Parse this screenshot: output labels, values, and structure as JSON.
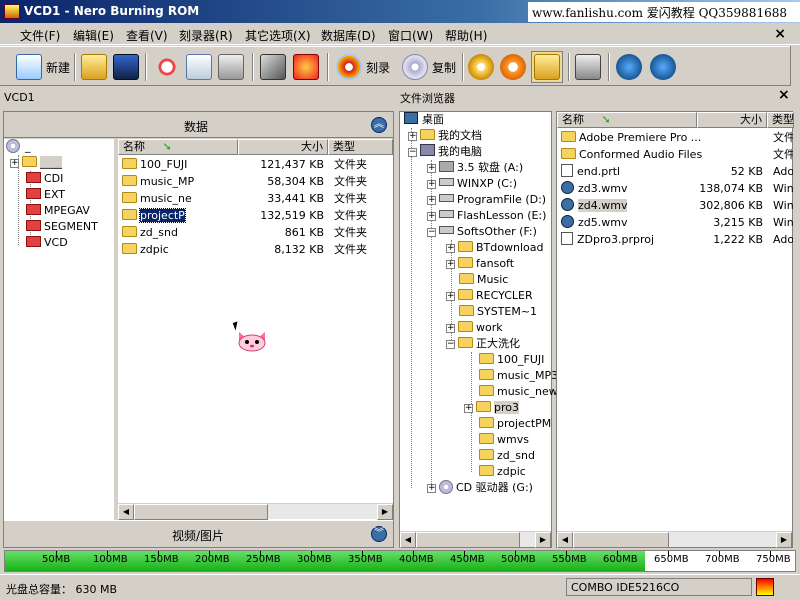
{
  "window": {
    "title": "VCD1 - Nero Burning ROM",
    "watermark": "www.fanlishu.com 爱闪教程 QQ359881688"
  },
  "menu": {
    "items": [
      "文件(F)",
      "编辑(E)",
      "查看(V)",
      "刻录器(R)",
      "其它选项(X)",
      "数据库(D)",
      "窗口(W)",
      "帮助(H)"
    ],
    "close": "×"
  },
  "toolbar": {
    "new_label": "新建",
    "burn_label": "刻录",
    "copy_label": "复制"
  },
  "compilation": {
    "label": "VCD1",
    "data_title": "数据",
    "video_title": "视频/图片",
    "tree": {
      "root": "_",
      "folder": "____",
      "items": [
        "CDI",
        "EXT",
        "MPEGAV",
        "SEGMENT",
        "VCD"
      ]
    },
    "columns": {
      "name": "名称",
      "size": "大小",
      "type": "类型"
    },
    "files": [
      {
        "name": "100_FUJI",
        "size": "121,437 KB",
        "type": "文件夹"
      },
      {
        "name": "music_MP",
        "size": "58,304 KB",
        "type": "文件夹"
      },
      {
        "name": "music_ne",
        "size": "33,441 KB",
        "type": "文件夹"
      },
      {
        "name": "projectP",
        "size": "132,519 KB",
        "type": "文件夹"
      },
      {
        "name": "zd_snd",
        "size": "861 KB",
        "type": "文件夹"
      },
      {
        "name": "zdpic",
        "size": "8,132 KB",
        "type": "文件夹"
      }
    ]
  },
  "browser": {
    "label": "文件浏览器",
    "close": "×",
    "tree": {
      "desktop": "桌面",
      "my_docs": "我的文档",
      "my_computer": "我的电脑",
      "drives": [
        "3.5 软盘 (A:)",
        "WINXP (C:)",
        "ProgramFile (D:)",
        "FlashLesson (E:)",
        "SoftsOther (F:)"
      ],
      "f_children": [
        "BTdownload",
        "fansoft",
        "Music",
        "RECYCLER",
        "SYSTEM~1",
        "work",
        "正大洗化"
      ],
      "zd_children": [
        "100_FUJI",
        "music_MP3",
        "music_new",
        "pro3",
        "projectPM",
        "wmvs",
        "zd_snd",
        "zdpic"
      ],
      "cd_drive": "CD 驱动器 (G:)"
    },
    "columns": {
      "name": "名称",
      "size": "大小",
      "type": "类型"
    },
    "files": [
      {
        "name": "Adobe Premiere Pro ...",
        "size": "",
        "type": "文件",
        "icon": "folder"
      },
      {
        "name": "Conformed Audio Files",
        "size": "",
        "type": "文件",
        "icon": "folder"
      },
      {
        "name": "end.prtl",
        "size": "52 KB",
        "type": "Ado",
        "icon": "file"
      },
      {
        "name": "zd3.wmv",
        "size": "138,074 KB",
        "type": "Wind",
        "icon": "wmv"
      },
      {
        "name": "zd4.wmv",
        "size": "302,806 KB",
        "type": "Wind",
        "icon": "wmv"
      },
      {
        "name": "zd5.wmv",
        "size": "3,215 KB",
        "type": "Wind",
        "icon": "wmv"
      },
      {
        "name": "ZDpro3.prproj",
        "size": "1,222 KB",
        "type": "Ado",
        "icon": "file"
      }
    ]
  },
  "capacity": {
    "ticks": [
      "50MB",
      "100MB",
      "150MB",
      "200MB",
      "250MB",
      "300MB",
      "350MB",
      "400MB",
      "450MB",
      "500MB",
      "550MB",
      "600MB",
      "650MB",
      "700MB",
      "750MB"
    ],
    "used_fraction": 0.81,
    "fill_color": "#22bb22"
  },
  "status": {
    "capacity_text": "光盘总容量： 630 MB",
    "drive_text": "COMBO   IDE5216CO"
  }
}
